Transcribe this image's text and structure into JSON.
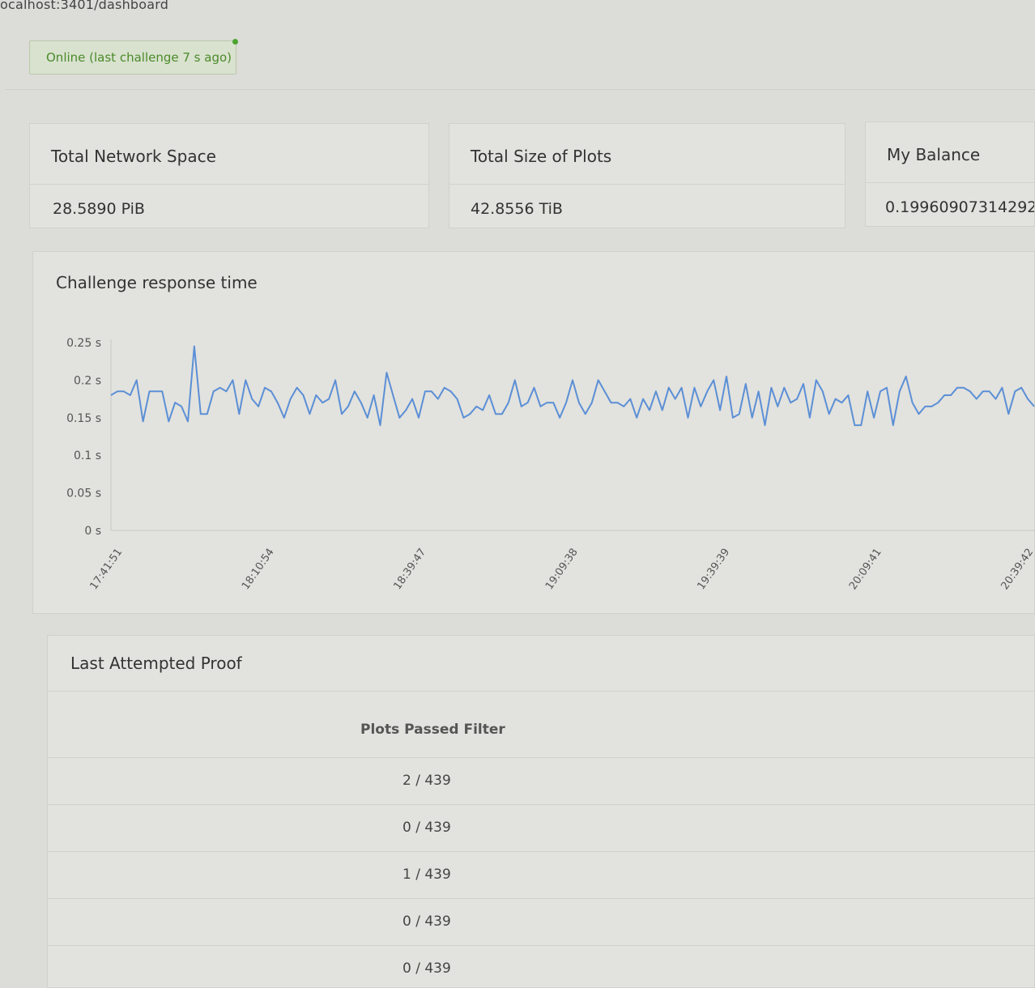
{
  "browser": {
    "url": "ocalhost:3401/dashboard"
  },
  "status": {
    "label": "Online (last challenge 7 s ago)",
    "color": "#4b8a2a"
  },
  "stats": [
    {
      "title": "Total Network Space",
      "value": "28.5890 PiB"
    },
    {
      "title": "Total Size of Plots",
      "value": "42.8556 TiB"
    },
    {
      "title": "My Balance",
      "value": "0.19960907314292"
    }
  ],
  "chart": {
    "title": "Challenge response time",
    "line_color": "#5b8fd6",
    "y_ticks": [
      "0.25 s",
      "0.2 s",
      "0.15 s",
      "0.1 s",
      "0.05 s",
      "0 s"
    ],
    "x_ticks": [
      "17:41:51",
      "18:10:54",
      "18:39:47",
      "19:09:38",
      "19:39:39",
      "20:09:41",
      "20:39:42"
    ]
  },
  "chart_data": {
    "type": "line",
    "title": "Challenge response time",
    "ylim": [
      0,
      0.25
    ],
    "y_unit": "s",
    "x_tick_labels": [
      "17:41:51",
      "18:10:54",
      "18:39:47",
      "19:09:38",
      "19:39:39",
      "20:09:41",
      "20:39:42"
    ],
    "series": [
      {
        "values": [
          0.18,
          0.185,
          0.185,
          0.18,
          0.2,
          0.145,
          0.185,
          0.185,
          0.185,
          0.145,
          0.17,
          0.165,
          0.145,
          0.245,
          0.155,
          0.155,
          0.185,
          0.19,
          0.185,
          0.2,
          0.155,
          0.2,
          0.175,
          0.165,
          0.19,
          0.185,
          0.17,
          0.15,
          0.175,
          0.19,
          0.18,
          0.155,
          0.18,
          0.17,
          0.175,
          0.2,
          0.155,
          0.165,
          0.185,
          0.17,
          0.15,
          0.18,
          0.14,
          0.21,
          0.18,
          0.15,
          0.16,
          0.175,
          0.15,
          0.185,
          0.185,
          0.175,
          0.19,
          0.185,
          0.175,
          0.15,
          0.155,
          0.165,
          0.16,
          0.18,
          0.155,
          0.155,
          0.17,
          0.2,
          0.165,
          0.17,
          0.19,
          0.165,
          0.17,
          0.17,
          0.15,
          0.17,
          0.2,
          0.17,
          0.155,
          0.17,
          0.2,
          0.185,
          0.17,
          0.17,
          0.165,
          0.175,
          0.15,
          0.175,
          0.16,
          0.185,
          0.16,
          0.19,
          0.175,
          0.19,
          0.15,
          0.19,
          0.165,
          0.185,
          0.2,
          0.16,
          0.205,
          0.15,
          0.155,
          0.195,
          0.15,
          0.185,
          0.14,
          0.19,
          0.165,
          0.19,
          0.17,
          0.175,
          0.195,
          0.15,
          0.2,
          0.185,
          0.155,
          0.175,
          0.17,
          0.18,
          0.14,
          0.14,
          0.185,
          0.15,
          0.185,
          0.19,
          0.14,
          0.185,
          0.205,
          0.17,
          0.155,
          0.165,
          0.165,
          0.17,
          0.18,
          0.18,
          0.19,
          0.19,
          0.185,
          0.175,
          0.185,
          0.185,
          0.175,
          0.19,
          0.155,
          0.185,
          0.19,
          0.175,
          0.165
        ]
      }
    ]
  },
  "proof": {
    "title": "Last Attempted Proof",
    "column_header": "Plots Passed Filter",
    "rows": [
      "2 / 439",
      "0 / 439",
      "1 / 439",
      "0 / 439",
      "0 / 439"
    ]
  }
}
